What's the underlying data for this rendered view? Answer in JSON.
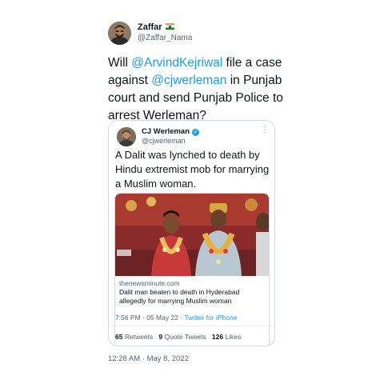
{
  "author": {
    "name": "Zaffar",
    "handle": "@Zaffar_Nama",
    "flag_icon": "india-flag-icon"
  },
  "tweet": {
    "parts": [
      {
        "text": "Will ",
        "type": "text"
      },
      {
        "text": "@ArvindKejriwal",
        "type": "mention"
      },
      {
        "text": " file a case against ",
        "type": "text"
      },
      {
        "text": "@cjwerleman",
        "type": "mention"
      },
      {
        "text": " in Punjab court and send Punjab Police to arrest Werleman?",
        "type": "text"
      }
    ],
    "timestamp": "12:28 AM · May 8, 2022"
  },
  "quoted": {
    "name": "CJ Werleman",
    "verified_icon": "verified-badge-icon",
    "handle": "@cjwerleman",
    "more_icon": "more-options-icon",
    "text": "A Dalit was lynched to death by Hindu extremist mob for marrying a Muslim woman.",
    "link": {
      "domain": "thenewsminute.com",
      "title": "Dalit man beaten to death in Hyderabad allegedly for marrying Muslim woman"
    },
    "time": "7:56 PM · 05 May 22 · ",
    "source": "Twitter for iPhone",
    "stats": {
      "retweets_count": "65",
      "retweets_label": "Retweets",
      "quotes_count": "9",
      "quotes_label": "Quote Tweets",
      "likes_count": "126",
      "likes_label": "Likes"
    }
  },
  "colors": {
    "accent": "#1d9bf0",
    "text": "#0f1419",
    "secondary": "#536471",
    "border": "#cfd9de"
  }
}
